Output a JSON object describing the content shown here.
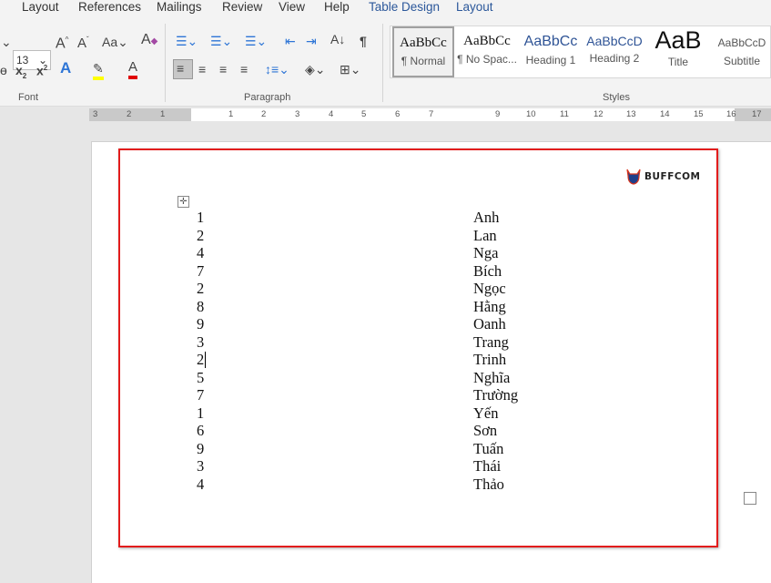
{
  "tabs": [
    "Layout",
    "References",
    "Mailings",
    "Review",
    "View",
    "Help",
    "Table Design",
    "Layout"
  ],
  "accent": "#2b579a",
  "font_group": {
    "size": "13",
    "label": "Font"
  },
  "paragraph_group": {
    "label": "Paragraph"
  },
  "styles_group": {
    "label": "Styles",
    "items": [
      {
        "preview": "AaBbCc",
        "name": "¶ Normal"
      },
      {
        "preview": "AaBbCc",
        "name": "¶ No Spac..."
      },
      {
        "preview": "AaBbCc",
        "name": "Heading 1"
      },
      {
        "preview": "AaBbCcD",
        "name": "Heading 2"
      },
      {
        "preview": "AaB",
        "name": "Title"
      },
      {
        "preview": "AaBbCcD",
        "name": "Subtitle"
      }
    ]
  },
  "ruler": {
    "left": [
      "3",
      "2",
      "1"
    ],
    "right": [
      "1",
      "2",
      "3",
      "4",
      "5",
      "6",
      "7",
      "9",
      "10",
      "11",
      "12",
      "13",
      "14",
      "15",
      "16",
      "17"
    ]
  },
  "logo": "BUFFCOM",
  "table": {
    "rows": [
      [
        "1",
        "Anh"
      ],
      [
        "2",
        "Lan"
      ],
      [
        "4",
        "Nga"
      ],
      [
        "7",
        "Bích"
      ],
      [
        "2",
        "Ngọc"
      ],
      [
        "8",
        "Hằng"
      ],
      [
        "9",
        "Oanh"
      ],
      [
        "3",
        "Trang"
      ],
      [
        "2",
        "Trinh"
      ],
      [
        "5",
        "Nghĩa"
      ],
      [
        "7",
        "Trường"
      ],
      [
        "1",
        "Yến"
      ],
      [
        "6",
        "Sơn"
      ],
      [
        "9",
        "Tuấn"
      ],
      [
        "3",
        "Thái"
      ],
      [
        "4",
        "Thảo"
      ]
    ]
  },
  "highlight_color": "#e21c1c"
}
